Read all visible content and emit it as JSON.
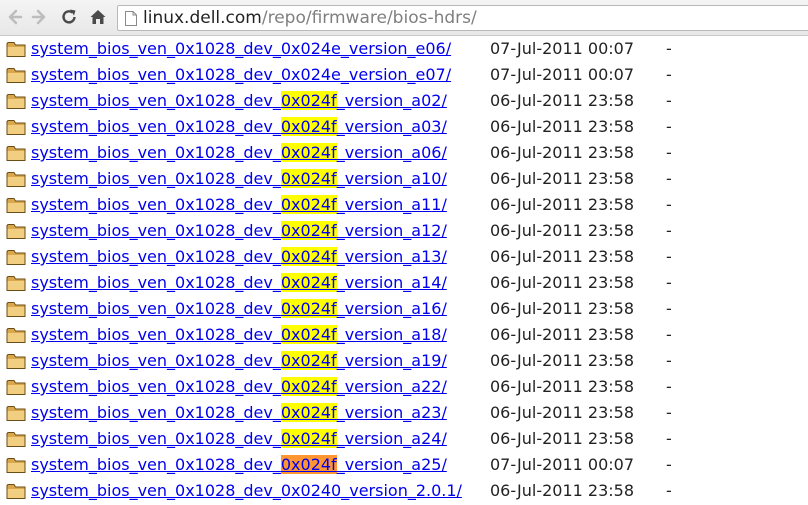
{
  "browser": {
    "url_domain": "linux.dell.com",
    "url_path": "/repo/firmware/bios-hdrs/"
  },
  "find_highlight": {
    "colors": {
      "match": "#ffff00",
      "active_match": "#ff9632"
    }
  },
  "listing": [
    {
      "pre": "system_bios_ven_0x1028_dev_0x024e_version_e06/",
      "hl": "",
      "post": "",
      "active": false,
      "date": "07-Jul-2011 00:07",
      "size": "-"
    },
    {
      "pre": "system_bios_ven_0x1028_dev_0x024e_version_e07/",
      "hl": "",
      "post": "",
      "active": false,
      "date": "07-Jul-2011 00:07",
      "size": "-"
    },
    {
      "pre": "system_bios_ven_0x1028_dev_",
      "hl": "0x024f",
      "post": "_version_a02/",
      "active": false,
      "date": "06-Jul-2011 23:58",
      "size": "-"
    },
    {
      "pre": "system_bios_ven_0x1028_dev_",
      "hl": "0x024f",
      "post": "_version_a03/",
      "active": false,
      "date": "06-Jul-2011 23:58",
      "size": "-"
    },
    {
      "pre": "system_bios_ven_0x1028_dev_",
      "hl": "0x024f",
      "post": "_version_a06/",
      "active": false,
      "date": "06-Jul-2011 23:58",
      "size": "-"
    },
    {
      "pre": "system_bios_ven_0x1028_dev_",
      "hl": "0x024f",
      "post": "_version_a10/",
      "active": false,
      "date": "06-Jul-2011 23:58",
      "size": "-"
    },
    {
      "pre": "system_bios_ven_0x1028_dev_",
      "hl": "0x024f",
      "post": "_version_a11/",
      "active": false,
      "date": "06-Jul-2011 23:58",
      "size": "-"
    },
    {
      "pre": "system_bios_ven_0x1028_dev_",
      "hl": "0x024f",
      "post": "_version_a12/",
      "active": false,
      "date": "06-Jul-2011 23:58",
      "size": "-"
    },
    {
      "pre": "system_bios_ven_0x1028_dev_",
      "hl": "0x024f",
      "post": "_version_a13/",
      "active": false,
      "date": "06-Jul-2011 23:58",
      "size": "-"
    },
    {
      "pre": "system_bios_ven_0x1028_dev_",
      "hl": "0x024f",
      "post": "_version_a14/",
      "active": false,
      "date": "06-Jul-2011 23:58",
      "size": "-"
    },
    {
      "pre": "system_bios_ven_0x1028_dev_",
      "hl": "0x024f",
      "post": "_version_a16/",
      "active": false,
      "date": "06-Jul-2011 23:58",
      "size": "-"
    },
    {
      "pre": "system_bios_ven_0x1028_dev_",
      "hl": "0x024f",
      "post": "_version_a18/",
      "active": false,
      "date": "06-Jul-2011 23:58",
      "size": "-"
    },
    {
      "pre": "system_bios_ven_0x1028_dev_",
      "hl": "0x024f",
      "post": "_version_a19/",
      "active": false,
      "date": "06-Jul-2011 23:58",
      "size": "-"
    },
    {
      "pre": "system_bios_ven_0x1028_dev_",
      "hl": "0x024f",
      "post": "_version_a22/",
      "active": false,
      "date": "06-Jul-2011 23:58",
      "size": "-"
    },
    {
      "pre": "system_bios_ven_0x1028_dev_",
      "hl": "0x024f",
      "post": "_version_a23/",
      "active": false,
      "date": "06-Jul-2011 23:58",
      "size": "-"
    },
    {
      "pre": "system_bios_ven_0x1028_dev_",
      "hl": "0x024f",
      "post": "_version_a24/",
      "active": false,
      "date": "06-Jul-2011 23:58",
      "size": "-"
    },
    {
      "pre": "system_bios_ven_0x1028_dev_",
      "hl": "0x024f",
      "post": "_version_a25/",
      "active": true,
      "date": "07-Jul-2011 00:07",
      "size": "-"
    },
    {
      "pre": "system_bios_ven_0x1028_dev_0x0240_version_2.0.1/",
      "hl": "",
      "post": "",
      "active": false,
      "date": "06-Jul-2011 23:58",
      "size": "-"
    }
  ]
}
